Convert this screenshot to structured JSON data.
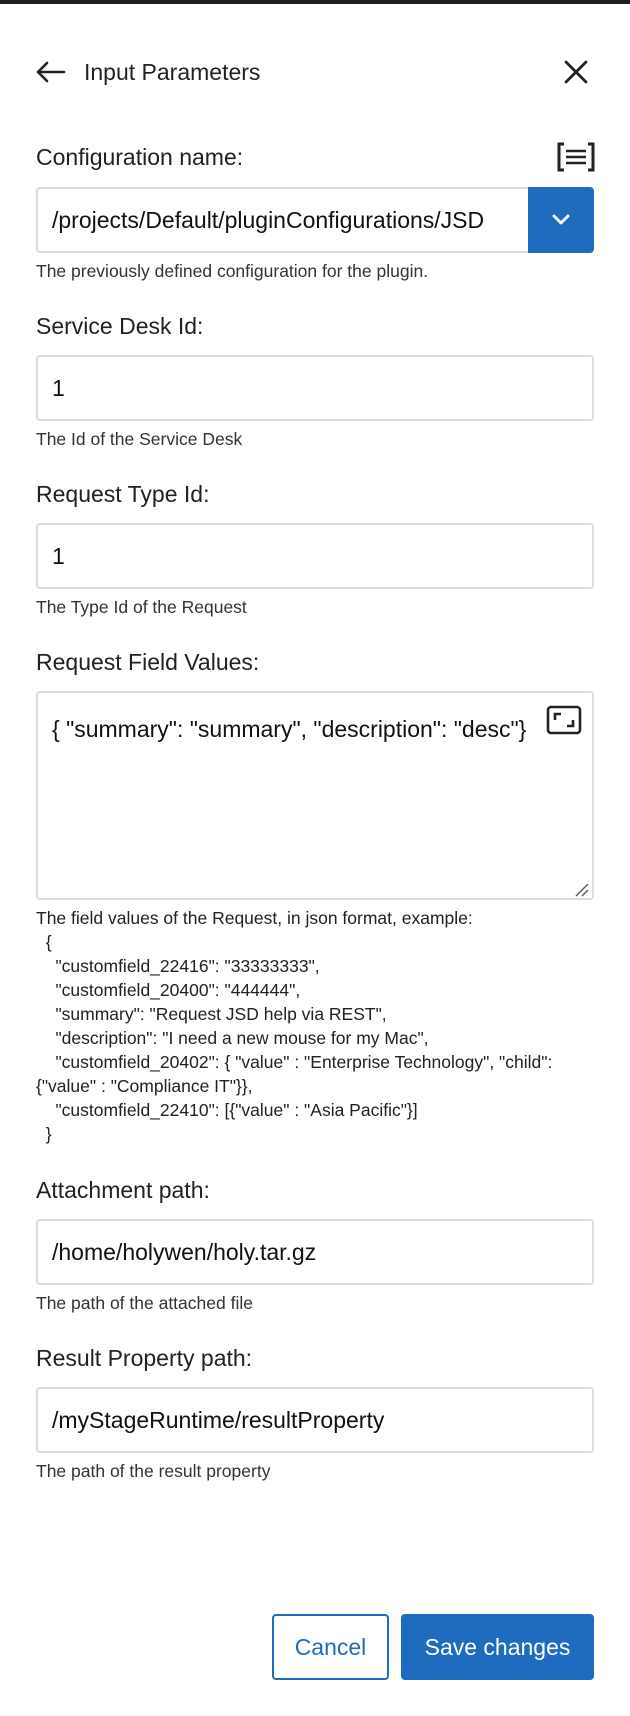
{
  "header": {
    "title": "Input Parameters"
  },
  "fields": {
    "configuration": {
      "label": "Configuration name:",
      "value": "/projects/Default/pluginConfigurations/JSD",
      "help": "The previously defined configuration for the plugin."
    },
    "service_desk": {
      "label": "Service Desk Id:",
      "value": "1",
      "help": "The Id of the Service Desk"
    },
    "request_type": {
      "label": "Request Type Id:",
      "value": "1",
      "help": "The Type Id of the Request"
    },
    "request_fields": {
      "label": "Request Field Values:",
      "value": "{  \"summary\": \"summary\",  \"description\": \"desc\"}",
      "help": "The field values of the Request, in json format, example:\n  {\n    \"customfield_22416\": \"33333333\",\n    \"customfield_20400\": \"444444\",\n    \"summary\": \"Request JSD help via REST\",\n    \"description\": \"I need a new mouse for my Mac\",\n    \"customfield_20402\": { \"value\" : \"Enterprise Technology\", \"child\": {\"value\" : \"Compliance IT\"}},\n    \"customfield_22410\": [{\"value\" : \"Asia Pacific\"}]\n  }"
    },
    "attachment": {
      "label": "Attachment path:",
      "value": "/home/holywen/holy.tar.gz",
      "help": "The path of the attached file"
    },
    "result_property": {
      "label": "Result Property path:",
      "value": "/myStageRuntime/resultProperty",
      "help": "The path of the result property"
    }
  },
  "footer": {
    "cancel_label": "Cancel",
    "save_label": "Save changes"
  },
  "colors": {
    "accent": "#1e6bbf",
    "border": "#d9dde0"
  }
}
